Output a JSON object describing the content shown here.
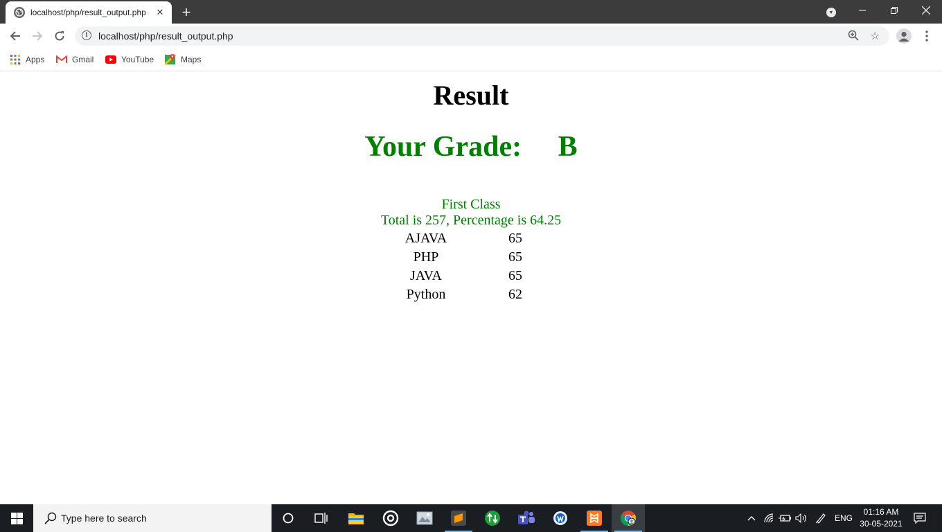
{
  "browser": {
    "tab_title": "localhost/php/result_output.php",
    "new_tab_label": "+",
    "url": "localhost/php/result_output.php",
    "bookmarks": [
      {
        "label": "Apps",
        "icon": "apps-grid-icon"
      },
      {
        "label": "Gmail",
        "icon": "gmail-icon"
      },
      {
        "label": "YouTube",
        "icon": "youtube-icon"
      },
      {
        "label": "Maps",
        "icon": "maps-icon"
      }
    ]
  },
  "page": {
    "heading": "Result",
    "grade_text": "Your Grade:     B",
    "class_text": "First Class",
    "total_text": "Total is 257, Percentage is 64.25",
    "marks": [
      {
        "subject": "AJAVA",
        "mark": "65"
      },
      {
        "subject": "PHP",
        "mark": "65"
      },
      {
        "subject": "JAVA",
        "mark": "65"
      },
      {
        "subject": "Python",
        "mark": "62"
      }
    ],
    "colors": {
      "grade": "#008000",
      "heading": "#000000"
    }
  },
  "taskbar": {
    "search_placeholder": "Type here to search",
    "language": "ENG",
    "time": "01:16 AM",
    "date": "30-05-2021"
  }
}
